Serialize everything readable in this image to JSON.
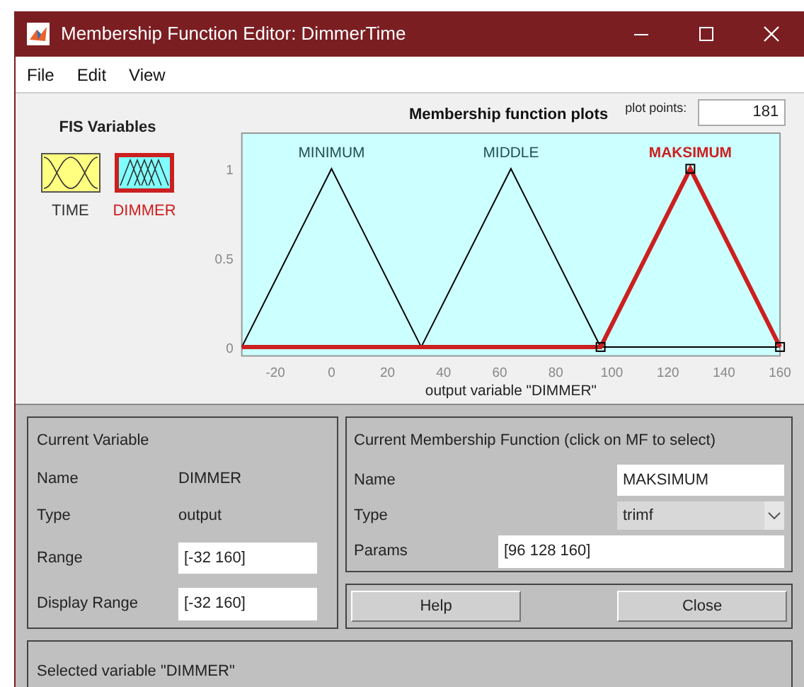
{
  "window": {
    "title": "Membership Function Editor: DimmerTime"
  },
  "menu": [
    "File",
    "Edit",
    "View"
  ],
  "fis_variables": {
    "title": "FIS Variables",
    "items": [
      {
        "label": "TIME",
        "kind": "input",
        "selected": false
      },
      {
        "label": "DIMMER",
        "kind": "output",
        "selected": true
      }
    ]
  },
  "plot": {
    "plot_points_label": "plot points:",
    "plot_points": "181",
    "chart_data": {
      "type": "line",
      "title": "Membership function plots",
      "xlabel": "output variable \"DIMMER\"",
      "x": [
        -32,
        0,
        32,
        64,
        96,
        128,
        160
      ],
      "series": [
        {
          "name": "MINIMUM",
          "color": "#000000",
          "values": [
            0,
            1,
            0,
            null,
            null,
            null,
            null
          ]
        },
        {
          "name": "MIDDLE",
          "color": "#000000",
          "values": [
            null,
            null,
            0,
            1,
            0,
            0,
            0
          ]
        },
        {
          "name": "MAKSIMUM",
          "color": "#cc1f1f",
          "values": [
            0,
            0,
            0,
            0,
            0,
            1,
            0
          ]
        }
      ],
      "xlim": [
        -32,
        160
      ],
      "ylim": [
        -0.05,
        1.2
      ],
      "xticks": [
        -20,
        0,
        20,
        40,
        60,
        80,
        100,
        120,
        140,
        160
      ],
      "yticks": [
        0,
        0.5,
        1
      ]
    },
    "mf_states": [
      {
        "selected": false
      },
      {
        "selected": false
      },
      {
        "selected": true
      }
    ]
  },
  "current_variable": {
    "title": "Current Variable",
    "name_label": "Name",
    "name": "DIMMER",
    "type_label": "Type",
    "type": "output",
    "range_label": "Range",
    "range": "[-32 160]",
    "display_range_label": "Display Range",
    "display_range": "[-32 160]"
  },
  "current_mf": {
    "title": "Current Membership Function (click on MF to select)",
    "name_label": "Name",
    "name": "MAKSIMUM",
    "type_label": "Type",
    "type": "trimf",
    "params_label": "Params",
    "params": "[96 128 160]"
  },
  "buttons": [
    "Help",
    "Close"
  ],
  "status": "Selected variable \"DIMMER\""
}
